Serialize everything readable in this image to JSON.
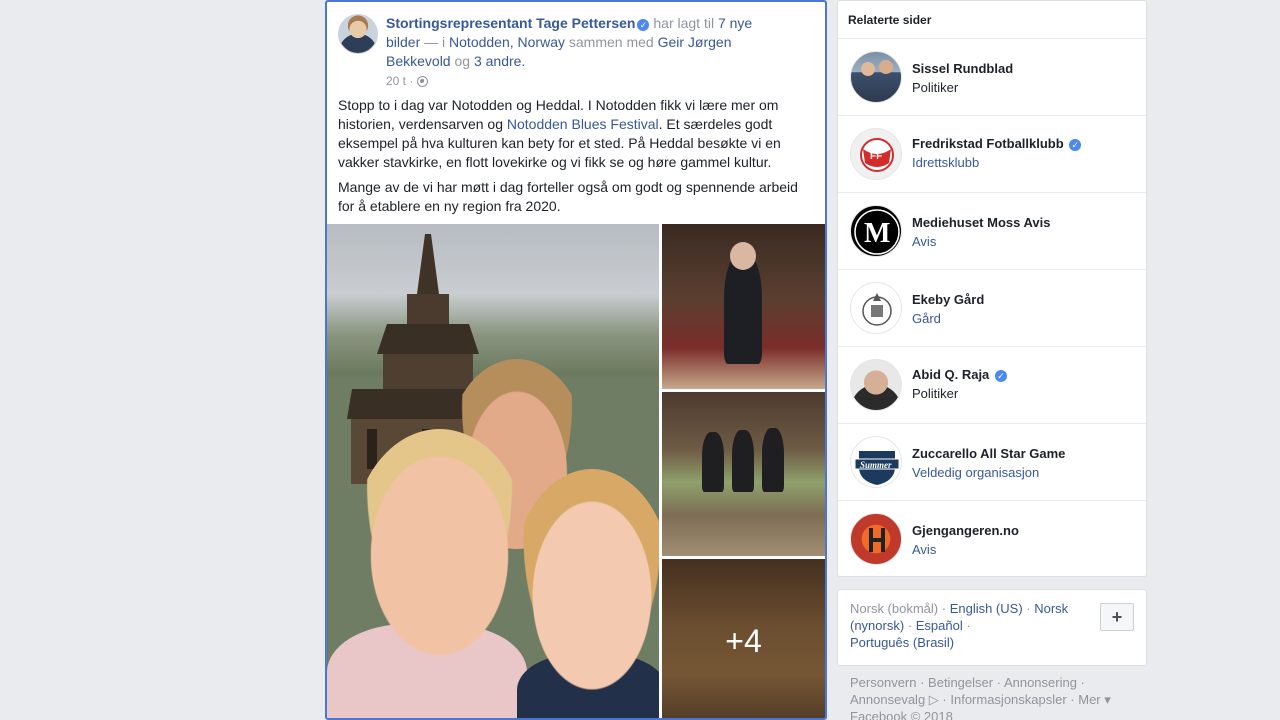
{
  "post": {
    "author": "Stortingsrepresentant Tage Pettersen",
    "action_text": " har lagt til ",
    "photos_link": "7 nye bilder",
    "in_text": " — i ",
    "location": "Notodden, Norway",
    "with_text": " sammen med ",
    "tagged_person": "Geir Jørgen Bekkevold",
    "and_text": " og ",
    "others_link": "3 andre.",
    "time": "20 t",
    "meta_sep": " · ",
    "body_p1_before": "Stopp to i dag var Notodden og Heddal. I Notodden fikk vi lære mer om historien, verdensarven og ",
    "body_p1_link": "Notodden Blues Festival",
    "body_p1_after": ". Et særdeles godt eksempel på hva kulturen kan bety for et sted. På Heddal besøkte vi en vakker stavkirke, en flott lovekirke og vi fikk se og høre gammel kultur.",
    "body_p2": "Mange av de vi har møtt i dag forteller også om godt og spennende arbeid for å etablere en ny region fra 2020.",
    "more_photos": "+4"
  },
  "related": {
    "title": "Relaterte sider",
    "items": [
      {
        "name": "Sissel Rundblad",
        "category": "Politiker",
        "verified": false,
        "category_link": false,
        "thumb": "people-photo"
      },
      {
        "name": "Fredrikstad Fotballklubb",
        "category": "Idrettsklubb",
        "verified": true,
        "category_link": true,
        "thumb": "ffk-logo"
      },
      {
        "name": "Mediehuset Moss Avis",
        "category": "Avis",
        "verified": false,
        "category_link": true,
        "thumb": "moss-avis-logo"
      },
      {
        "name": "Ekeby Gård",
        "category": "Gård",
        "verified": false,
        "category_link": true,
        "thumb": "ekeby-logo"
      },
      {
        "name": "Abid Q. Raja",
        "category": "Politiker",
        "verified": true,
        "category_link": false,
        "thumb": "portrait-photo"
      },
      {
        "name": "Zuccarello All Star Game",
        "category": "Veldedig organisasjon",
        "verified": false,
        "category_link": true,
        "thumb": "summer-logo"
      },
      {
        "name": "Gjengangeren.no",
        "category": "Avis",
        "verified": false,
        "category_link": true,
        "thumb": "gjengangeren-logo"
      }
    ]
  },
  "languages": {
    "current": "Norsk (bokmål)",
    "options": [
      "English (US)",
      "Norsk (nynorsk)",
      "Español",
      "Português (Brasil)"
    ],
    "sep": " · ",
    "add_label": "+"
  },
  "footer": {
    "links": [
      "Personvern",
      "Betingelser",
      "Annonsering",
      "Annonsevalg",
      "Informasjonskapsler",
      "Mer"
    ],
    "sep": " · ",
    "copyright": "Facebook © 2018"
  },
  "colors": {
    "link": "#385898",
    "verified": "#4b88f0",
    "background": "#e9ebee",
    "focus_border": "#4a76d4"
  }
}
